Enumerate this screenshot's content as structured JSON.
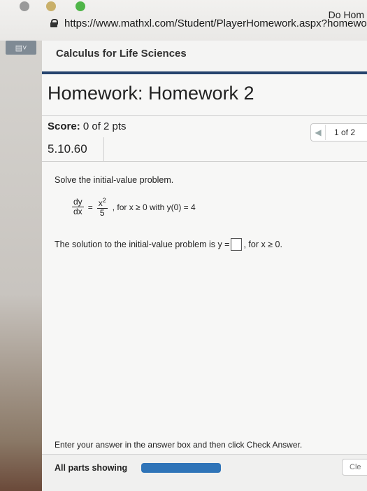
{
  "browser": {
    "tab_title": "Do Hom",
    "url": "https://www.mathxl.com/Student/PlayerHomework.aspx?homewo",
    "sidebar_toggle": "▤˅"
  },
  "course": {
    "title": "Calculus for Life Sciences"
  },
  "homework": {
    "title": "Homework: Homework 2",
    "score_label": "Score:",
    "score_value": " 0 of 2 pts",
    "pager_text": "1 of 2",
    "question_number": "5.10.60"
  },
  "question": {
    "prompt": "Solve the initial-value problem.",
    "eq_num1": "dy",
    "eq_den1": "dx",
    "eq_equals": "=",
    "eq_num2_base": "x",
    "eq_num2_exp": "2",
    "eq_den2": "5",
    "eq_condition": ", for x ≥ 0 with y(0) = 4",
    "solution_prefix": "The solution to the initial-value problem is y =",
    "solution_suffix": ", for x ≥ 0."
  },
  "footer": {
    "instructions": "Enter your answer in the answer box and then click Check Answer.",
    "parts_label": "All parts showing",
    "progress_fraction": 1.0,
    "clear_label": "Cle"
  },
  "colors": {
    "accent_bar": "#26446e",
    "progress": "#2f74b8"
  }
}
